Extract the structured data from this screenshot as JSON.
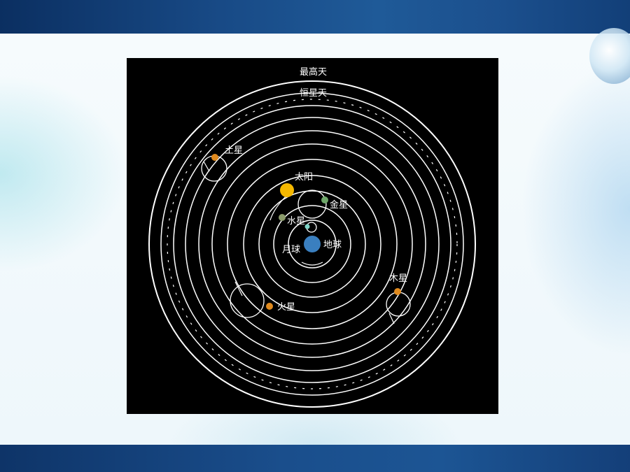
{
  "labels": {
    "highest_heaven": "最高天",
    "fixed_star_heaven": "恒星天",
    "saturn": "土星",
    "sun": "太阳",
    "venus": "金星",
    "mercury": "水星",
    "moon": "月球",
    "earth": "地球",
    "jupiter": "木星",
    "mars": "火星"
  },
  "colors": {
    "background": "#000000",
    "orbit_line": "#ffffff",
    "sun": "#f5b800",
    "earth": "#3a7fbf",
    "planet_orange": "#e08a1e",
    "venus": "#6fa86a",
    "mercury": "#8a9a6a",
    "moon": "#7fd6c8"
  }
}
